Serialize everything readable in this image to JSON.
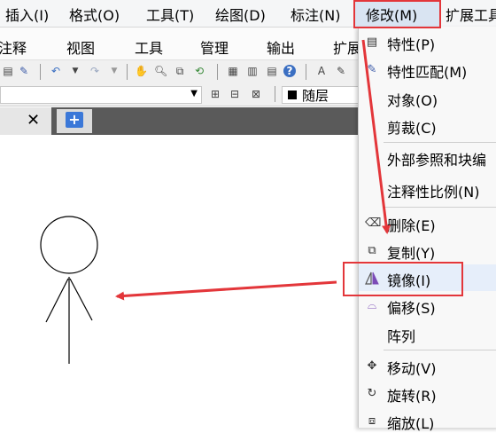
{
  "menubar": {
    "items": [
      {
        "label": "插入(I)"
      },
      {
        "label": "格式(O)"
      },
      {
        "label": "工具(T)"
      },
      {
        "label": "绘图(D)"
      },
      {
        "label": "标注(N)"
      },
      {
        "label": "修改(M)"
      },
      {
        "label": "扩展工具"
      }
    ]
  },
  "ribbon": {
    "tabs": [
      {
        "label": "注释"
      },
      {
        "label": "视图"
      },
      {
        "label": "工具"
      },
      {
        "label": "管理"
      },
      {
        "label": "输出"
      },
      {
        "label": "扩展"
      }
    ]
  },
  "toolbar": {
    "layer_value": "随层"
  },
  "doc_tab": {
    "close_glyph": "✕",
    "new_glyph": "+"
  },
  "modify_menu": {
    "items": [
      {
        "label": "特性(P)",
        "icon": "properties-icon"
      },
      {
        "label": "特性匹配(M)",
        "icon": "match-brush-icon"
      },
      {
        "label": "对象(O)",
        "icon": ""
      },
      {
        "label": "剪裁(C)",
        "icon": ""
      },
      {
        "label": "外部参照和块编",
        "icon": ""
      },
      {
        "label": "注释性比例(N)",
        "icon": ""
      },
      {
        "label": "删除(E)",
        "icon": "eraser-icon"
      },
      {
        "label": "复制(Y)",
        "icon": "copy-icon"
      },
      {
        "label": "镜像(I)",
        "icon": "mirror-icon"
      },
      {
        "label": "偏移(S)",
        "icon": "offset-icon"
      },
      {
        "label": "阵列",
        "icon": ""
      },
      {
        "label": "移动(V)",
        "icon": "move-icon"
      },
      {
        "label": "旋转(R)",
        "icon": "rotate-icon"
      },
      {
        "label": "缩放(L)",
        "icon": "scale-icon"
      }
    ]
  },
  "colors": {
    "highlight": "#e3363a",
    "arrow": "#e3363a"
  }
}
